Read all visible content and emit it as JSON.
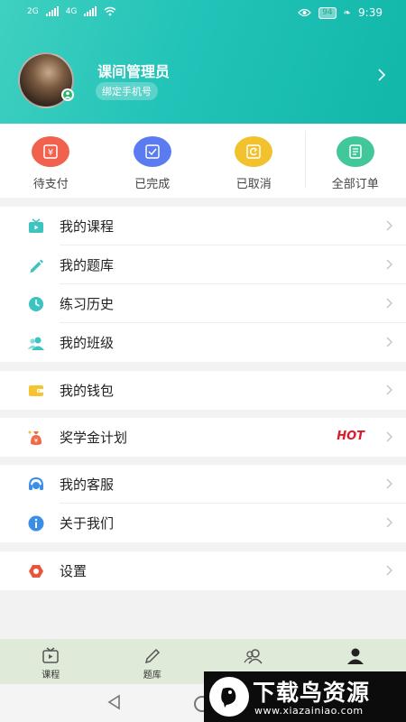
{
  "status": {
    "network_a": "2G",
    "network_b": "4G",
    "battery": "94",
    "time": "9:39"
  },
  "profile": {
    "name": "课间管理员",
    "bind_phone": "绑定手机号"
  },
  "orders": [
    {
      "label": "待支付",
      "icon": "wallet-yen-icon",
      "color": "#f0624d"
    },
    {
      "label": "已完成",
      "icon": "check-list-icon",
      "color": "#5b7cf0"
    },
    {
      "label": "已取消",
      "icon": "cancel-refresh-icon",
      "color": "#f2c12e"
    },
    {
      "label": "全部订单",
      "icon": "document-list-icon",
      "color": "#41c79a"
    }
  ],
  "menu": {
    "my_courses": "我的课程",
    "my_questions": "我的题库",
    "practice_history": "练习历史",
    "my_class": "我的班级",
    "my_wallet": "我的钱包",
    "scholarship": "奖学金计划",
    "hot_badge": "HOT",
    "customer_service": "我的客服",
    "about_us": "关于我们",
    "settings": "设置"
  },
  "tabs": [
    {
      "label": "课程",
      "icon": "tv-play-icon"
    },
    {
      "label": "题库",
      "icon": "pencil-icon"
    },
    {
      "label": "",
      "icon": "users-icon"
    },
    {
      "label": "",
      "icon": "person-icon"
    }
  ],
  "watermark": {
    "title": "下载鸟资源",
    "url": "www.xiazainiao.com"
  },
  "colors": {
    "accent": "#22c3b8",
    "hot": "#e0192a"
  }
}
